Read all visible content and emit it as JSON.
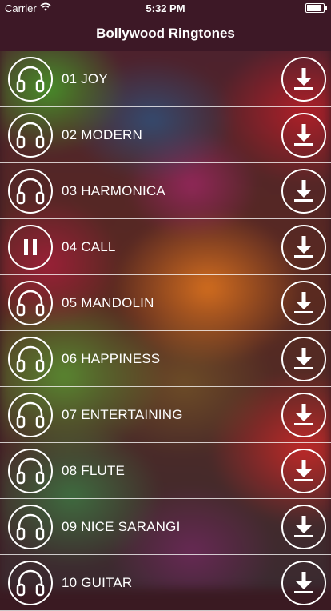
{
  "status_bar": {
    "carrier": "Carrier",
    "time": "5:32 PM",
    "wifi_icon": "wifi-icon",
    "battery_icon": "battery-icon"
  },
  "nav": {
    "title": "Bollywood Ringtones"
  },
  "ringtones": [
    {
      "label": "01 JOY",
      "state": "headphones"
    },
    {
      "label": "02 MODERN",
      "state": "headphones"
    },
    {
      "label": "03 HARMONICA",
      "state": "headphones"
    },
    {
      "label": "04 CALL",
      "state": "playing"
    },
    {
      "label": "05 MANDOLIN",
      "state": "headphones"
    },
    {
      "label": "06 HAPPINESS",
      "state": "headphones"
    },
    {
      "label": "07 ENTERTAINING",
      "state": "headphones"
    },
    {
      "label": "08 FLUTE",
      "state": "headphones"
    },
    {
      "label": "09 NICE SARANGI",
      "state": "headphones"
    },
    {
      "label": "10 GUITAR",
      "state": "headphones"
    }
  ],
  "icons": {
    "row_idle": "headphones-icon",
    "row_playing": "pause-icon",
    "row_action": "download-icon"
  }
}
